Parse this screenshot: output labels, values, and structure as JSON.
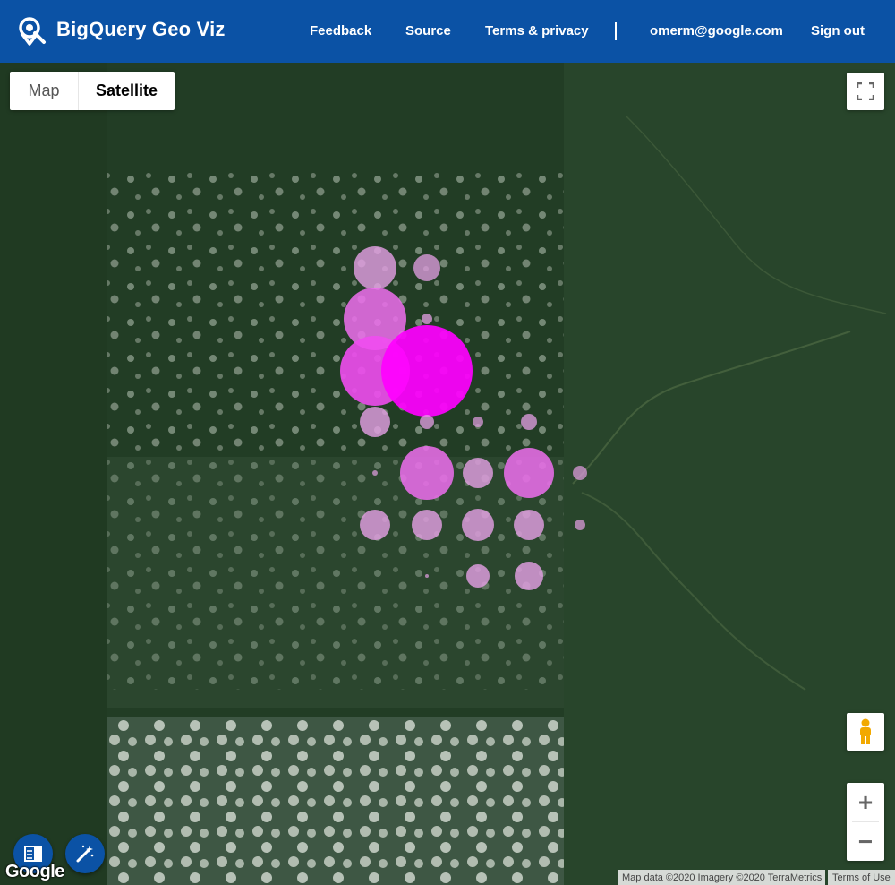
{
  "header": {
    "app_title": "BigQuery Geo Viz",
    "nav": {
      "feedback": "Feedback",
      "source": "Source",
      "terms": "Terms & privacy",
      "user_email": "omerm@google.com",
      "sign_out": "Sign out"
    }
  },
  "map": {
    "type_control": {
      "map_label": "Map",
      "satellite_label": "Satellite",
      "selected": "Satellite"
    },
    "zoom": {
      "in_label": "+",
      "out_label": "−"
    },
    "logo_text": "Google",
    "attribution": "Map data ©2020 Imagery ©2020 TerraMetrics",
    "terms_of_use": "Terms of Use",
    "fab_left_icon": "table-panel-icon",
    "fab_right_icon": "magic-wand-icon",
    "fullscreen_icon": "fullscreen-icon",
    "pegman_icon": "pegman-icon"
  },
  "colors": {
    "header_bg": "#0b52a5",
    "forest": "#223d25",
    "marker_strong": "#ff00ff",
    "marker_light": "#e6a0e6"
  }
}
